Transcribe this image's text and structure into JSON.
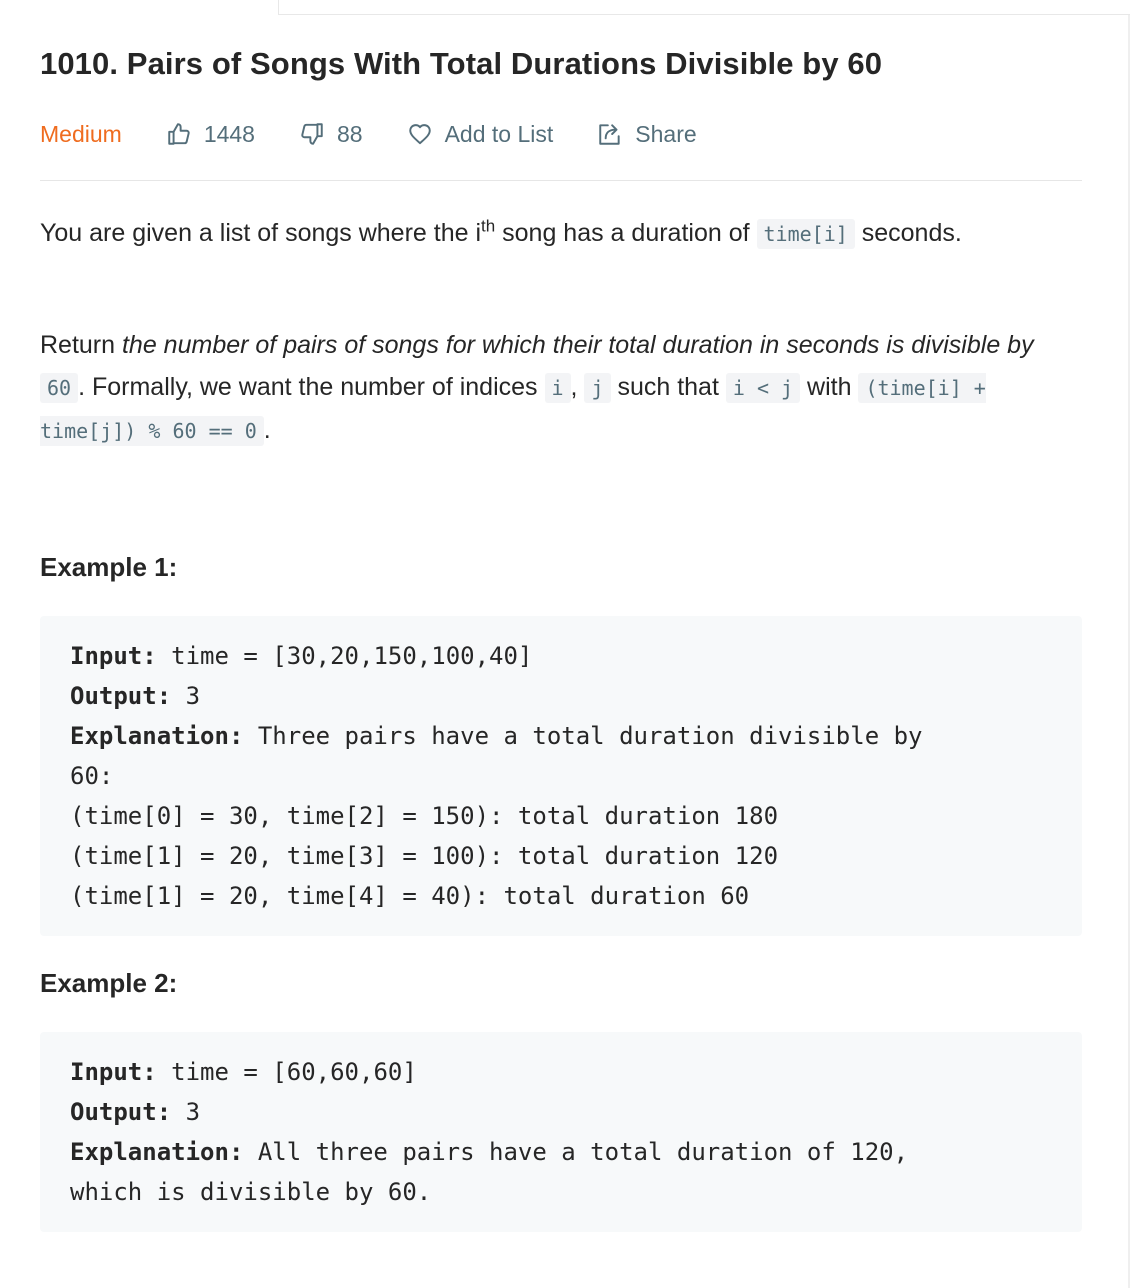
{
  "problem": {
    "title": "1010. Pairs of Songs With Total Durations Divisible by 60",
    "difficulty": "Medium",
    "likes": "1448",
    "dislikes": "88",
    "add_to_list": "Add to List",
    "share": "Share"
  },
  "description": {
    "p1_a": "You are given a list of songs where the i",
    "p1_sup": "th",
    "p1_b": " song has a duration of ",
    "p1_code": "time[i]",
    "p1_c": " seconds.",
    "p2_a": "Return ",
    "p2_em": "the number of pairs of songs for which their total duration in seconds is divisible by",
    "p2_code1": "60",
    "p2_b": ". Formally, we want the number of indices ",
    "p2_code_i": "i",
    "p2_comma": ", ",
    "p2_code_j": "j",
    "p2_c": " such that ",
    "p2_code_cond": "i < j",
    "p2_d": " with ",
    "p2_code_expr": "(time[i] + time[j]) % 60 == 0",
    "p2_end": "."
  },
  "examples": [
    {
      "title": "Example 1:",
      "input_label": "Input:",
      "input_value": " time = [30,20,150,100,40]",
      "output_label": "Output:",
      "output_value": " 3",
      "explanation_label": "Explanation:",
      "explanation_lines": [
        " Three pairs have a total duration divisible by",
        "60:",
        "(time[0] = 30, time[2] = 150): total duration 180",
        "(time[1] = 20, time[3] = 100): total duration 120",
        "(time[1] = 20, time[4] = 40): total duration 60"
      ]
    },
    {
      "title": "Example 2:",
      "input_label": "Input:",
      "input_value": " time = [60,60,60]",
      "output_label": "Output:",
      "output_value": " 3",
      "explanation_label": "Explanation:",
      "explanation_lines": [
        " All three pairs have a total duration of 120,",
        "which is divisible by 60."
      ]
    }
  ],
  "colors": {
    "difficulty": "#ef6c1f",
    "meta_text": "#546e7a",
    "code_bg": "#f7f9fa"
  },
  "icons": [
    "thumbs-up-icon",
    "thumbs-down-icon",
    "heart-icon",
    "share-icon"
  ]
}
